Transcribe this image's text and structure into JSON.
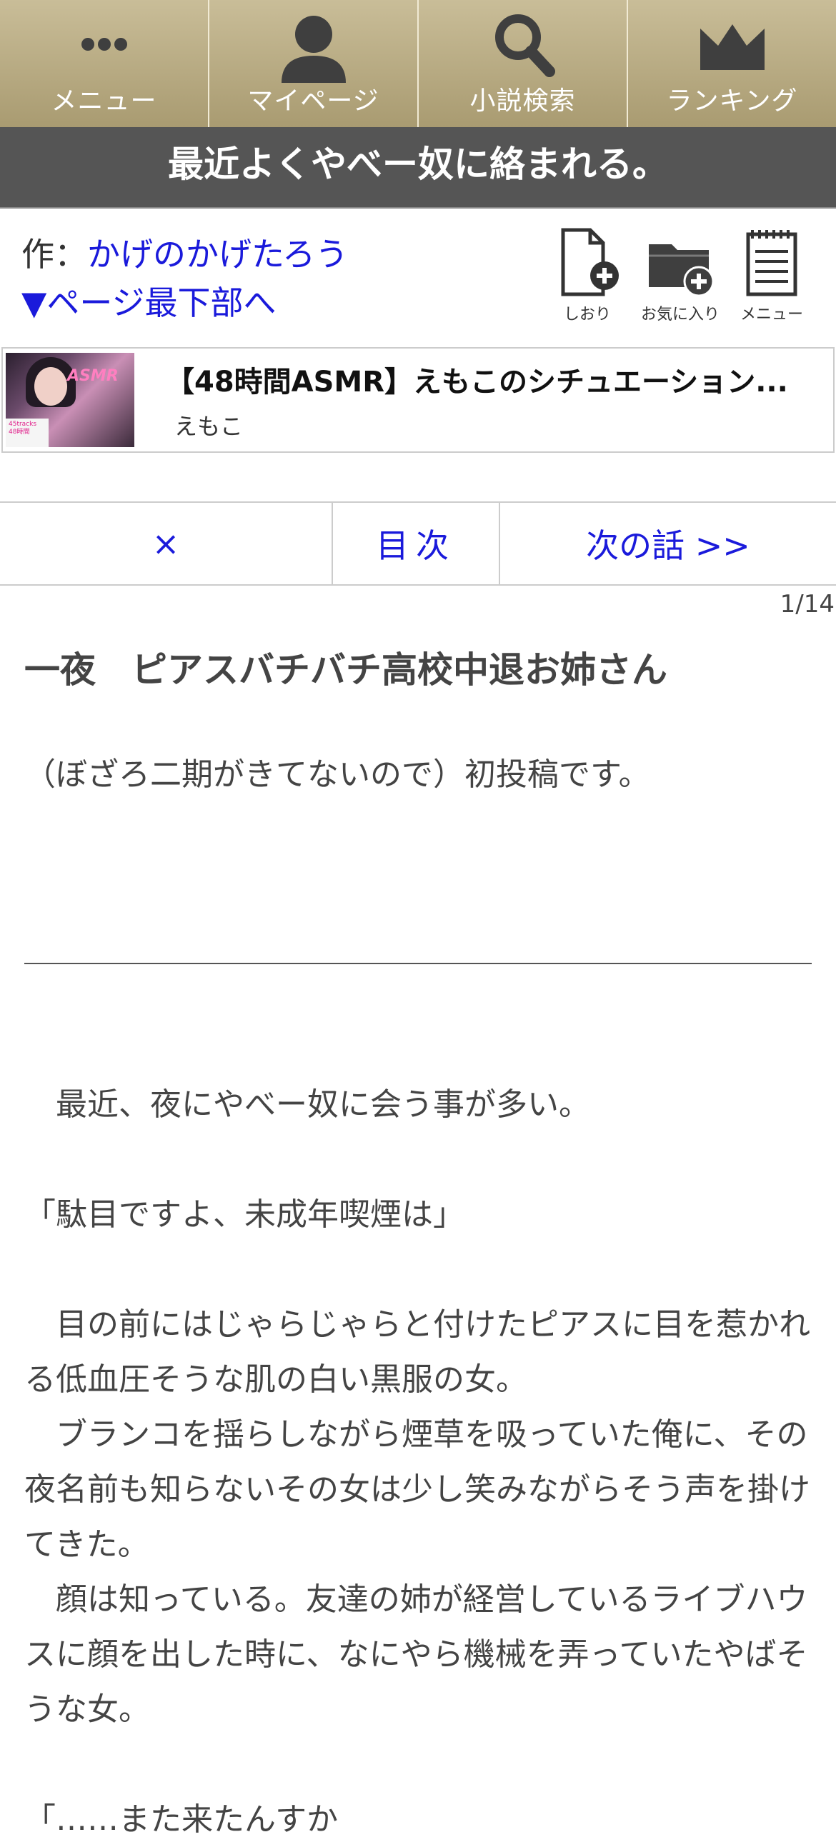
{
  "nav": {
    "items": [
      {
        "label": "メニュー",
        "icon": "dots-icon"
      },
      {
        "label": "マイページ",
        "icon": "person-icon"
      },
      {
        "label": "小説検索",
        "icon": "search-icon"
      },
      {
        "label": "ランキング",
        "icon": "crown-icon"
      }
    ]
  },
  "title": "最近よくやべー奴に絡まれる。",
  "author": {
    "prefix": "作：",
    "name": "かげのかげたろう",
    "jump_link": "▼ページ最下部へ"
  },
  "tools": {
    "bookmark": "しおり",
    "favorite": "お気に入り",
    "menu": "メニュー"
  },
  "ad": {
    "title": "【48時間ASMR】えもこのシチュエーション...",
    "author": "えもこ",
    "thumb_text": "ASMR",
    "thumb_small": "45tracks 48時間"
  },
  "chapter_nav": {
    "close": "×",
    "toc": "目次",
    "next": "次の話 >>"
  },
  "page_count": "1/14",
  "episode_title": "一夜　ピアスバチバチ高校中退お姉さん",
  "preface": "（ぼざろ二期がきてないので）初投稿です。",
  "body": {
    "p1": "　最近、夜にやべー奴に会う事が多い。",
    "p2": "「駄目ですよ、未成年喫煙は」",
    "p3": "　目の前にはじゃらじゃらと付けたピアスに目を惹かれる低血圧そうな肌の白い黒服の女。",
    "p4": "　ブランコを揺らしながら煙草を吸っていた俺に、その夜名前も知らないその女は少し笑みながらそう声を掛けてきた。",
    "p5": "　顔は知っている。友達の姉が経営しているライブハウスに顔を出した時に、なにやら機械を弄っていたやばそうな女。",
    "p6": "「……また来たんすか"
  },
  "colors": {
    "nav_bg": "#b5a87f",
    "title_bg": "#555555",
    "link": "#1a1adb"
  }
}
